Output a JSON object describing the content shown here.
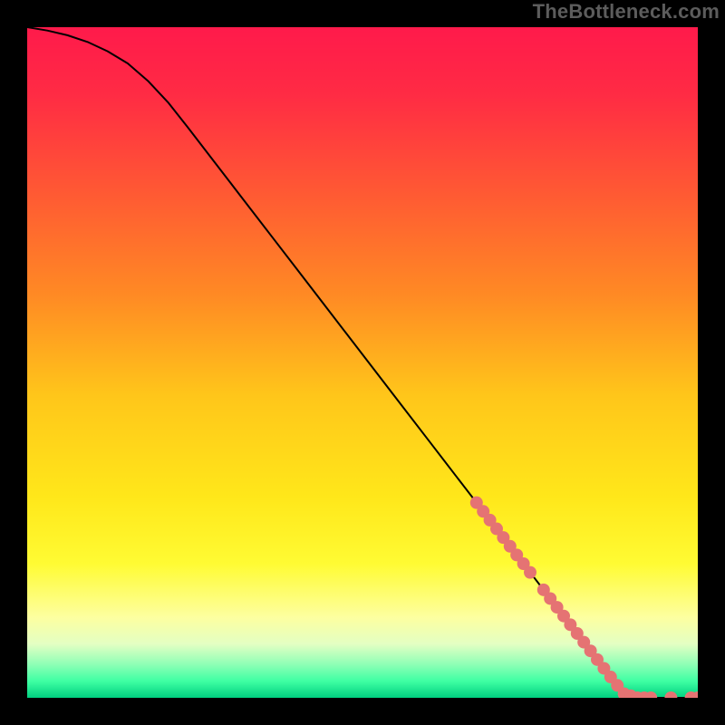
{
  "watermark": "TheBottleneck.com",
  "chart_data": {
    "type": "line",
    "title": "",
    "xlabel": "",
    "ylabel": "",
    "xlim": [
      0,
      100
    ],
    "ylim": [
      0,
      100
    ],
    "x": [
      0,
      3,
      6,
      9,
      12,
      15,
      18,
      21,
      24,
      28,
      32,
      36,
      40,
      44,
      48,
      52,
      56,
      60,
      64,
      68,
      72,
      75,
      78,
      81,
      83,
      85,
      87,
      89,
      91,
      93,
      95,
      97,
      100
    ],
    "values": [
      100,
      99.5,
      98.8,
      97.8,
      96.4,
      94.6,
      92.0,
      88.8,
      85.0,
      79.8,
      74.6,
      69.4,
      64.2,
      59.0,
      53.8,
      48.6,
      43.4,
      38.2,
      33.0,
      27.8,
      22.6,
      18.7,
      14.8,
      10.9,
      8.3,
      5.7,
      3.1,
      0.6,
      0.0,
      0.0,
      0.0,
      0.0,
      0.0
    ],
    "gradient_stops": [
      {
        "offset": 0.0,
        "color": "#ff1a4b"
      },
      {
        "offset": 0.1,
        "color": "#ff2b44"
      },
      {
        "offset": 0.25,
        "color": "#ff5a33"
      },
      {
        "offset": 0.4,
        "color": "#ff8a24"
      },
      {
        "offset": 0.55,
        "color": "#ffc61a"
      },
      {
        "offset": 0.7,
        "color": "#ffe71a"
      },
      {
        "offset": 0.8,
        "color": "#fffb33"
      },
      {
        "offset": 0.88,
        "color": "#fdffa0"
      },
      {
        "offset": 0.92,
        "color": "#e3ffc3"
      },
      {
        "offset": 0.95,
        "color": "#8fffb6"
      },
      {
        "offset": 0.975,
        "color": "#3fffa3"
      },
      {
        "offset": 1.0,
        "color": "#00d080"
      }
    ],
    "markers_x": [
      67,
      68,
      69,
      70,
      71,
      72,
      73,
      74,
      75,
      77,
      78,
      79,
      80,
      81,
      82,
      83,
      84,
      85,
      86,
      87,
      88,
      89,
      90,
      91,
      92,
      93,
      96,
      99,
      100
    ],
    "marker_radius": 7,
    "marker_color": "#e57373",
    "line_color": "#000000",
    "line_width": 2
  }
}
